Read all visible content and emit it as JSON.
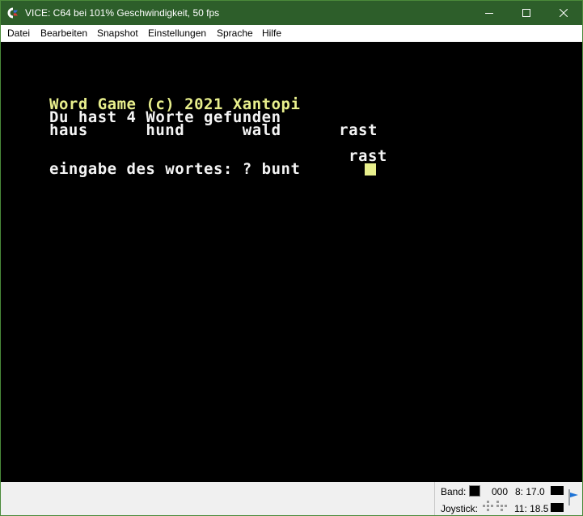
{
  "window": {
    "title": "VICE: C64 bei 101% Geschwindigkeit, 50 fps",
    "icon": "commodore-logo-icon",
    "controls": {
      "minimize": "minimize-icon",
      "maximize": "maximize-icon",
      "close": "close-icon"
    },
    "titlebar_color": "#2d5e2a"
  },
  "menu": {
    "items": [
      "Datei",
      "Bearbeiten",
      "Snapshot",
      "Einstellungen",
      "Sprache",
      "Hilfe"
    ]
  },
  "screen": {
    "background": "#000000",
    "lines": [
      "Word Game (c) 2021 Xantopi",
      "Du hast 4 Worte gefunden",
      "haus      hund      wald      rast",
      "                               rast",
      "eingabe des wortes: ? bunt"
    ],
    "text_colors": {
      "yellow": "#e8ef8c",
      "white": "#f4f4f4"
    },
    "cursor": "block-cursor"
  },
  "status": {
    "tape_label": "Band:",
    "tape_counter": "000",
    "joystick_label": "Joystick:",
    "drive8": "8: 17.0",
    "drive11": "11: 18.5",
    "volume_icon": "volume-icon"
  }
}
